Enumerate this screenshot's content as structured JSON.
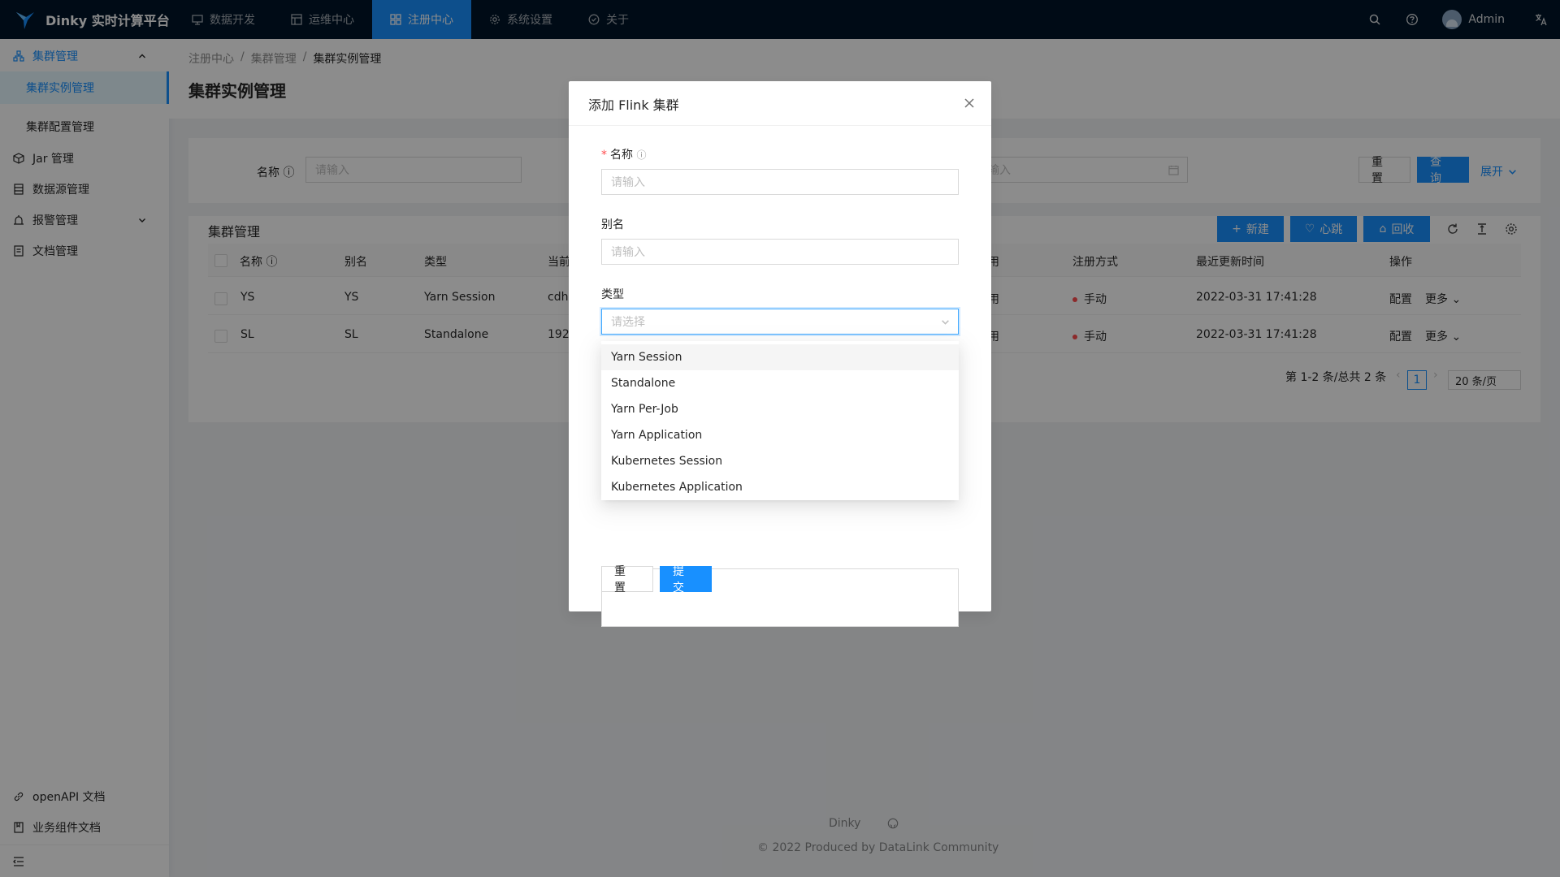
{
  "app": {
    "title": "Dinky 实时计算平台"
  },
  "topnav": [
    {
      "label": "数据开发",
      "icon": "monitor-icon"
    },
    {
      "label": "运维中心",
      "icon": "grid-icon"
    },
    {
      "label": "注册中心",
      "icon": "appstore-icon",
      "active": true
    },
    {
      "label": "系统设置",
      "icon": "gear-icon"
    },
    {
      "label": "关于",
      "icon": "info-circle-icon"
    }
  ],
  "header": {
    "user": "Admin"
  },
  "sidebar": {
    "group": "集群管理",
    "sub_items": [
      {
        "label": "集群实例管理",
        "selected": true
      },
      {
        "label": "集群配置管理"
      }
    ],
    "items": [
      {
        "label": "Jar 管理"
      },
      {
        "label": "数据源管理"
      },
      {
        "label": "报警管理"
      },
      {
        "label": "文档管理"
      }
    ],
    "bottom": [
      {
        "label": "openAPI 文档"
      },
      {
        "label": "业务组件文档"
      }
    ]
  },
  "breadcrumb": [
    "注册中心",
    "集群管理",
    "集群实例管理"
  ],
  "page_title": "集群实例管理",
  "search": {
    "name_label": "名称",
    "name_placeholder": "请输入",
    "date_placeholder": "输入",
    "reset": "重 置",
    "query": "查 询",
    "expand": "展开"
  },
  "table": {
    "title": "集群管理",
    "toolbar": {
      "new": "新建",
      "heartbeat": "心跳",
      "recycle": "回收"
    },
    "headers": {
      "name": "名称",
      "alias": "别名",
      "type": "类型",
      "current": "当前",
      "enabled_tail": "用",
      "register": "注册方式",
      "updated": "最近更新时间",
      "action": "操作"
    },
    "rows": [
      {
        "name": "YS",
        "alias": "YS",
        "type": "Yarn Session",
        "current": "cdh",
        "enabled_tail": "用",
        "register": "手动",
        "updated": "2022-03-31 17:41:28",
        "config": "配置",
        "more": "更多"
      },
      {
        "name": "SL",
        "alias": "SL",
        "type": "Standalone",
        "current": "192.",
        "enabled_tail": "用",
        "register": "手动",
        "updated": "2022-03-31 17:41:28",
        "config": "配置",
        "more": "更多"
      }
    ],
    "pagination": {
      "summary": "第 1-2 条/总共 2 条",
      "page": "1",
      "page_size": "20 条/页"
    }
  },
  "footer": {
    "name": "Dinky",
    "copyright": "2022 Produced by DataLink Community"
  },
  "modal": {
    "title": "添加 Flink 集群",
    "fields": {
      "name_label": "名称",
      "name_placeholder": "请输入",
      "alias_label": "别名",
      "alias_placeholder": "请输入",
      "type_label": "类型",
      "type_placeholder": "请选择"
    },
    "type_options": [
      "Yarn Session",
      "Standalone",
      "Yarn Per-Job",
      "Yarn Application",
      "Kubernetes Session",
      "Kubernetes Application"
    ],
    "buttons": {
      "reset": "重 置",
      "submit": "提 交"
    }
  },
  "colors": {
    "primary": "#1890ff",
    "header_bg": "#001529",
    "danger": "#ff4d4f"
  }
}
